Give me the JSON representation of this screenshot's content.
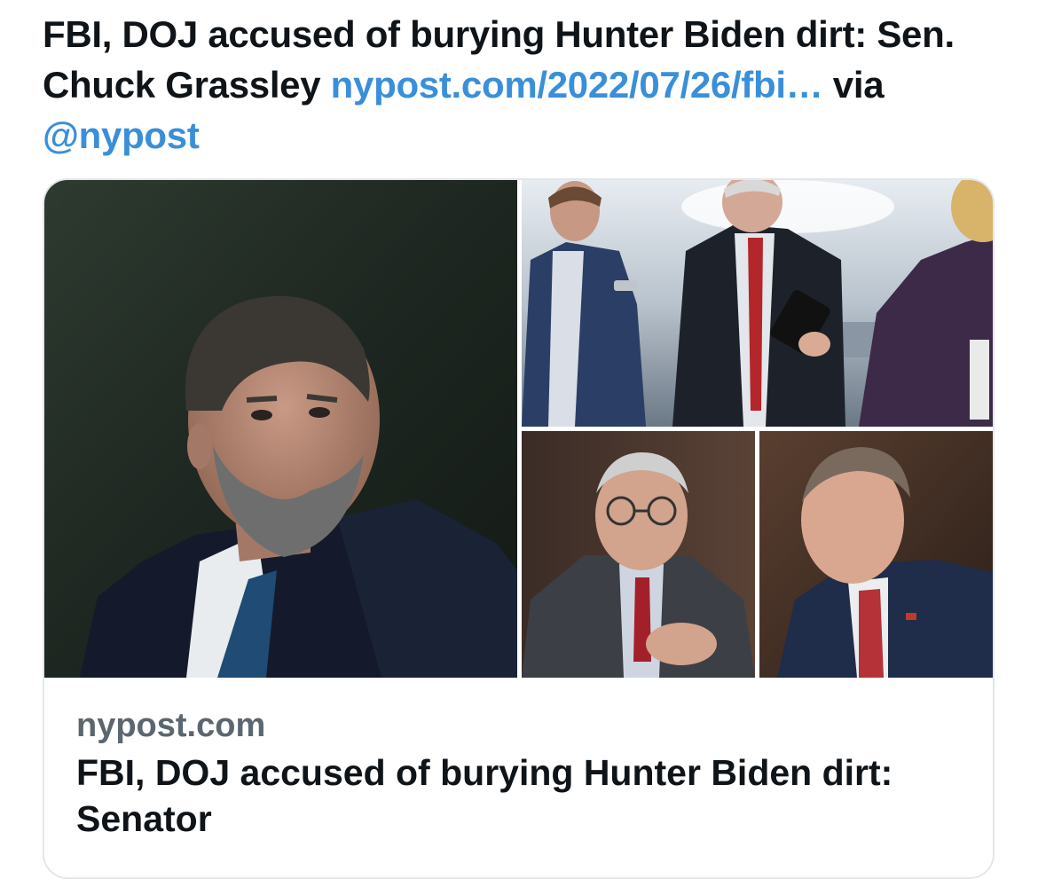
{
  "tweet": {
    "text_start": "FBI, DOJ accused of burying Hunter Biden dirt: Sen. Chuck Grassley ",
    "link_text": "nypost.com/2022/07/26/fbi…",
    "via_text": " via ",
    "mention": "@nypost"
  },
  "card": {
    "domain": "nypost.com",
    "title": "FBI, DOJ accused of burying Hunter Biden dirt: Senator",
    "images": [
      {
        "name": "main-photo"
      },
      {
        "name": "hallway-photo"
      },
      {
        "name": "garland-photo"
      },
      {
        "name": "wray-photo"
      }
    ]
  },
  "colors": {
    "link": "#3a8fd8",
    "text": "#0f1419",
    "muted": "#5b6670",
    "border": "#e3e7eb"
  }
}
